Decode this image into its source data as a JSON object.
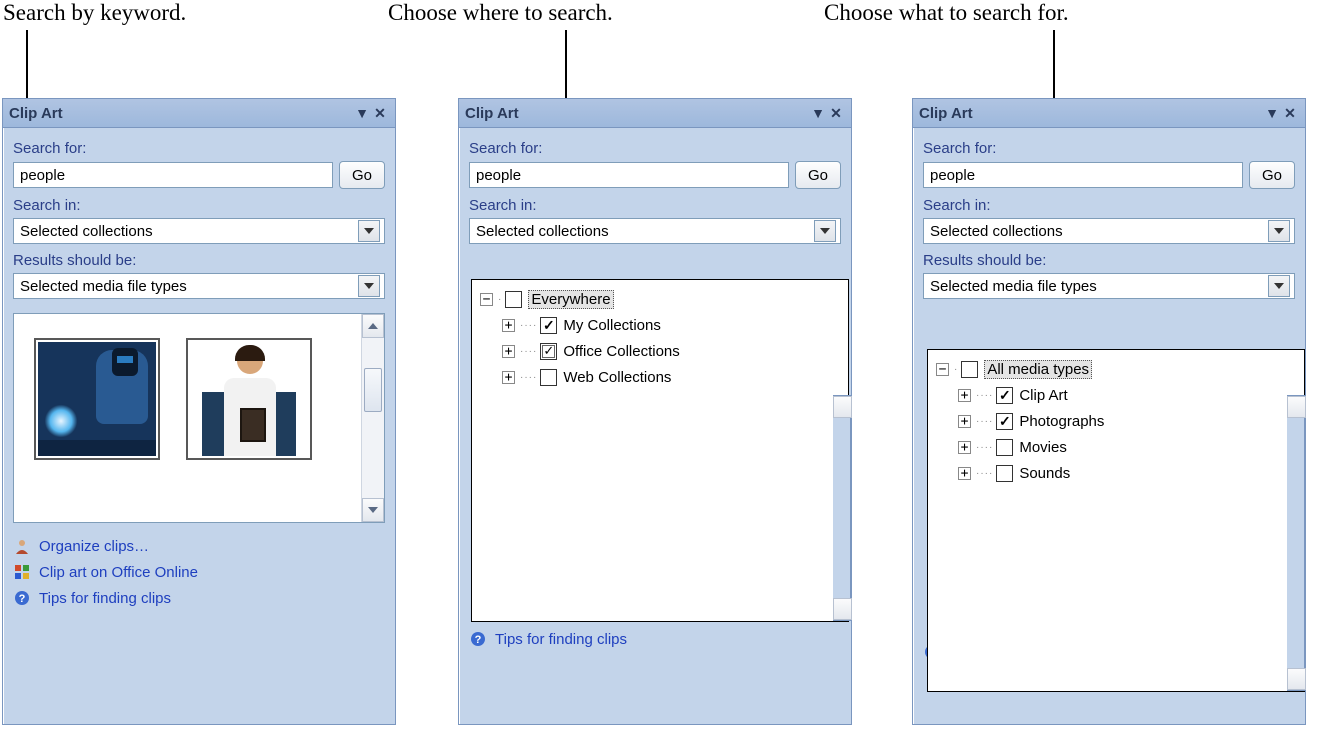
{
  "callouts": {
    "keyword": "Search by keyword.",
    "where": "Choose where to search.",
    "what": "Choose what to search for."
  },
  "panel": {
    "title": "Clip Art",
    "search_for_label": "Search for:",
    "search_value": "people",
    "go_label": "Go",
    "search_in_label": "Search in:",
    "search_in_value": "Selected collections",
    "results_label": "Results should be:",
    "results_value": "Selected media file types"
  },
  "links": {
    "organize": "Organize clips…",
    "online": "Clip art on Office Online",
    "tips": "Tips for finding clips"
  },
  "tree_where": {
    "root": "Everywhere",
    "items": [
      {
        "label": "My Collections",
        "state": "checked"
      },
      {
        "label": "Office Collections",
        "state": "mixed"
      },
      {
        "label": "Web Collections",
        "state": "unchecked"
      }
    ]
  },
  "tree_what": {
    "root": "All media types",
    "items": [
      {
        "label": "Clip Art",
        "state": "checked"
      },
      {
        "label": "Photographs",
        "state": "checked"
      },
      {
        "label": "Movies",
        "state": "unchecked"
      },
      {
        "label": "Sounds",
        "state": "unchecked"
      }
    ]
  }
}
